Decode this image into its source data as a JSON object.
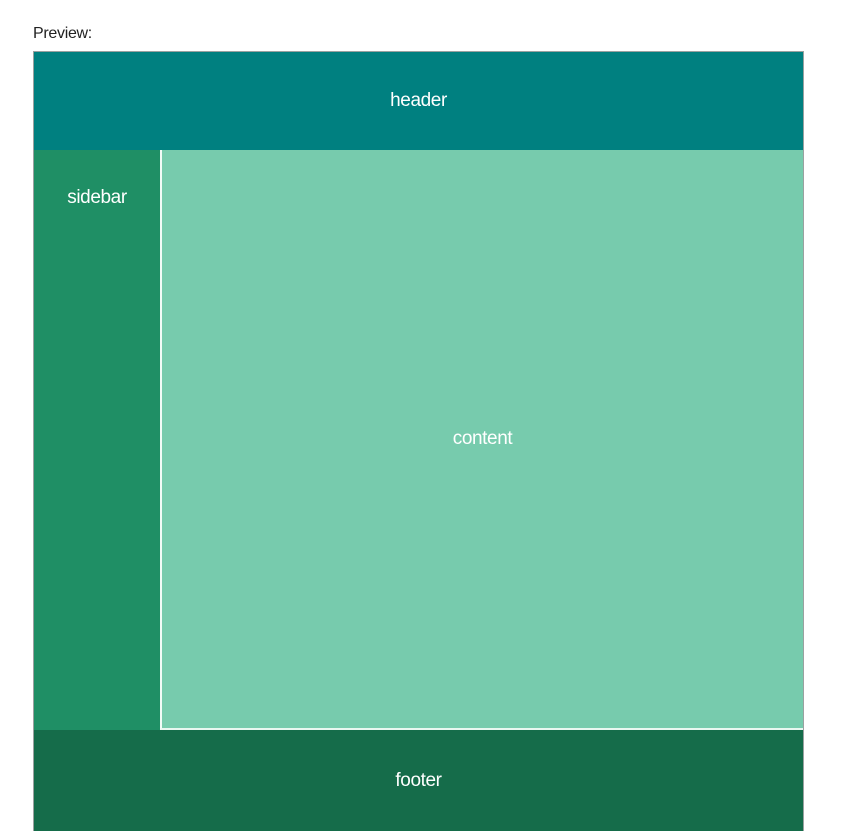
{
  "preview": {
    "label": "Preview:"
  },
  "layout": {
    "header": "header",
    "sidebar": "sidebar",
    "content": "content",
    "footer": "footer"
  },
  "colors": {
    "header": "#008080",
    "sidebar": "#1f8f65",
    "content": "#77cbad",
    "footer": "#156c4a",
    "text": "#ffffff"
  }
}
